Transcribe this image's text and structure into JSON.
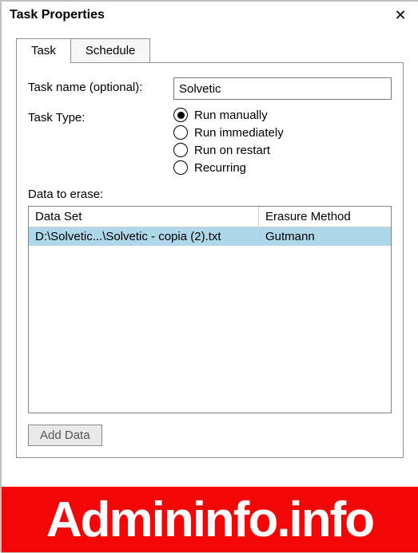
{
  "window": {
    "title": "Task Properties",
    "close_icon": "✕"
  },
  "tabs": [
    {
      "label": "Task",
      "active": true
    },
    {
      "label": "Schedule",
      "active": false
    }
  ],
  "form": {
    "task_name_label": "Task name (optional):",
    "task_name_value": "Solvetic",
    "task_type_label": "Task Type:",
    "task_type_options": [
      {
        "label": "Run manually",
        "selected": true
      },
      {
        "label": "Run immediately",
        "selected": false
      },
      {
        "label": "Run on restart",
        "selected": false
      },
      {
        "label": "Recurring",
        "selected": false
      }
    ],
    "data_to_erase_label": "Data to erase:"
  },
  "grid": {
    "columns": [
      {
        "label": "Data Set"
      },
      {
        "label": "Erasure Method"
      }
    ],
    "rows": [
      {
        "data_set": "D:\\Solvetic...\\Solvetic - copia (2).txt",
        "method": "Gutmann",
        "selected": true
      }
    ]
  },
  "buttons": {
    "add_data": "Add Data"
  },
  "watermark": "Admininfo.info"
}
